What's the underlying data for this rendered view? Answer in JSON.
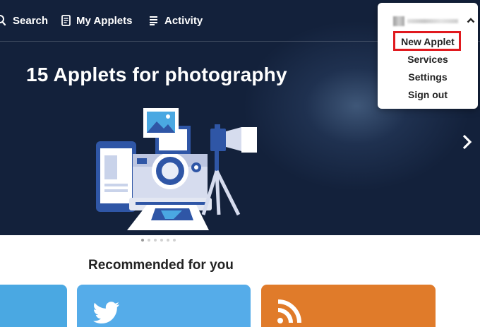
{
  "nav": {
    "search_label": "Search",
    "my_applets_label": "My Applets",
    "activity_label": "Activity"
  },
  "hero": {
    "title": "15 Applets for photography",
    "slide_count": 6,
    "active_slide": 1
  },
  "recommended": {
    "title": "Recommended for you",
    "cards": [
      {
        "color": "#4aa8e2",
        "icon": "blank"
      },
      {
        "color": "#55ace9",
        "icon": "twitter-bird-icon"
      },
      {
        "color": "#e07b2a",
        "icon": "rss-feed-icon"
      }
    ]
  },
  "user_menu": {
    "items": [
      "New Applet",
      "Services",
      "Settings",
      "Sign out"
    ],
    "highlighted": "New Applet"
  },
  "colors": {
    "hero_bg": "#13213b",
    "highlight_border": "#e0191e"
  }
}
